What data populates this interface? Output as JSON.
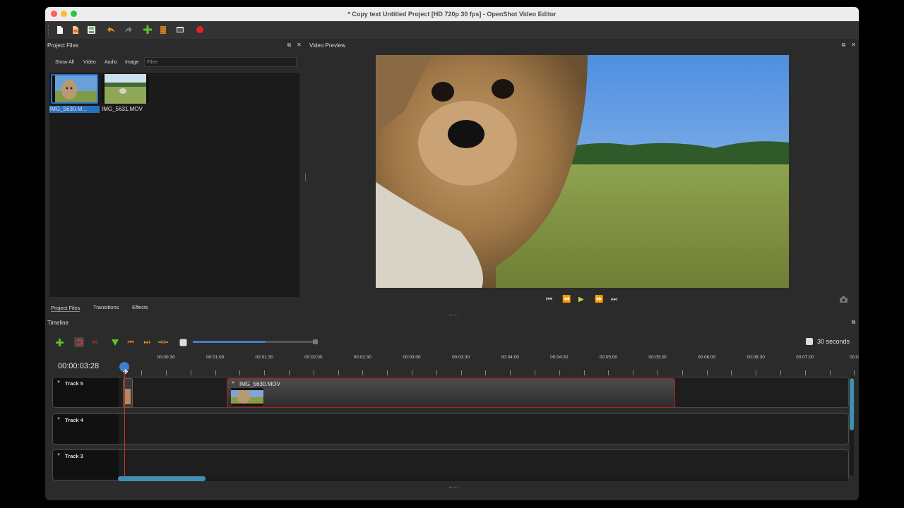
{
  "window": {
    "title": "* Copy text    Untitled Project [HD 720p 30 fps] - OpenShot Video Editor"
  },
  "toolbar": {
    "icons": [
      "new-project-icon",
      "open-project-icon",
      "save-project-icon",
      "undo-icon",
      "redo-icon",
      "import-files-icon",
      "profile-icon",
      "fullscreen-icon",
      "export-video-icon"
    ]
  },
  "project_files": {
    "title": "Project Files",
    "filters": [
      "Show All",
      "Video",
      "Audio",
      "Image"
    ],
    "filter_placeholder": "Filter",
    "files": [
      {
        "name": "IMG_5630.M...",
        "selected": true
      },
      {
        "name": "IMG_5631.MOV",
        "selected": false
      }
    ]
  },
  "bottom_tabs": [
    "Project Files",
    "Transitions",
    "Effects"
  ],
  "video_preview": {
    "title": "Video Preview"
  },
  "timeline": {
    "title": "Timeline",
    "timecode": "00:00:03:28",
    "zoom_label": "30 seconds",
    "zoom_level": 0.59,
    "ruler_labels": [
      "00:00:30",
      "00:01:00",
      "00:01:30",
      "00:02:00",
      "00:02:30",
      "00:03:00",
      "00:03:30",
      "00:04:00",
      "00:04:30",
      "00:05:00",
      "00:05:30",
      "00:06:00",
      "00:06:30",
      "00:07:00",
      "00:0"
    ],
    "tracks": [
      {
        "name": "Track 5"
      },
      {
        "name": "Track 4"
      },
      {
        "name": "Track 3"
      }
    ],
    "clip_name": "IMG_5630.MOV"
  },
  "colors": {
    "accent_blue": "#3f7fcf",
    "playhead": "#d33030",
    "clip_border": "#b02020",
    "add_green": "#5ec22a"
  }
}
